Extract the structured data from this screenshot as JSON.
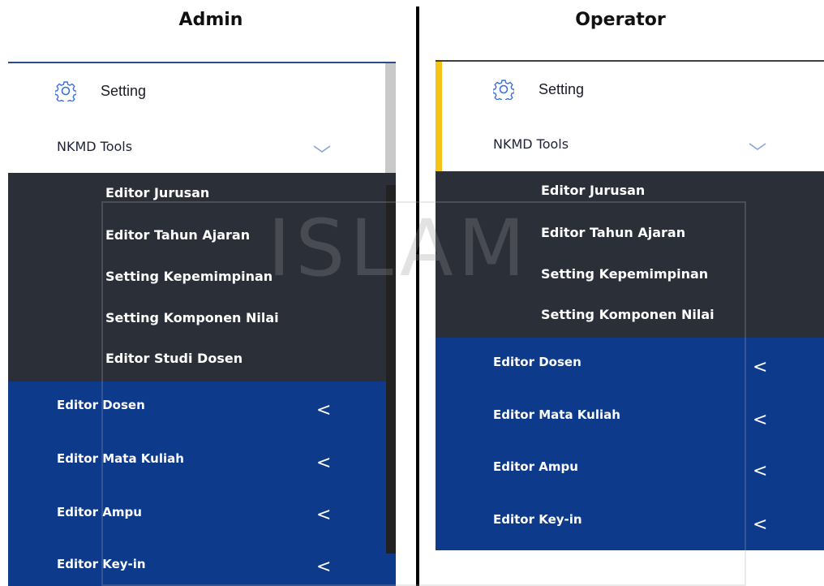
{
  "admin": {
    "title": "Admin",
    "setting_label": "Setting",
    "nkmd_label": "NKMD Tools",
    "sub_items": [
      "Editor Jurusan",
      "Editor Tahun Ajaran",
      "Setting Kepemimpinan",
      "Setting Komponen Nilai",
      "Editor Studi Dosen"
    ],
    "blue_items": [
      "Editor Dosen",
      "Editor Mata Kuliah",
      "Editor Ampu",
      "Editor Key-in"
    ]
  },
  "operator": {
    "title": "Operator",
    "setting_label": "Setting",
    "nkmd_label": "NKMD Tools",
    "sub_items": [
      "Editor Jurusan",
      "Editor Tahun Ajaran",
      "Setting Kepemimpinan",
      "Setting Komponen Nilai"
    ],
    "blue_items": [
      "Editor Dosen",
      "Editor Mata Kuliah",
      "Editor Ampu",
      "Editor Key-in"
    ]
  },
  "icons": {
    "setting": "gear-icon",
    "expand": "chevron-down-icon",
    "collapse": "chevron-left-icon"
  },
  "caret_glyph": "<",
  "watermark": "ISLAM",
  "colors": {
    "submenu_bg": "#2b2f38",
    "blue_bg": "#0e3a8c",
    "accent": "#f3c316"
  }
}
